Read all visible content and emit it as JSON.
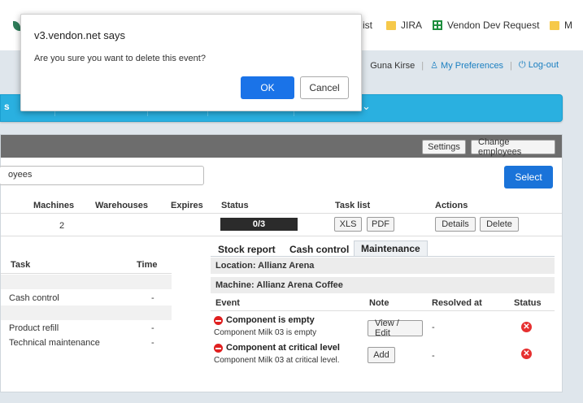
{
  "bookmarks": {
    "item1": "ist",
    "item2": "JIRA",
    "item3": "Vendon Dev Request",
    "item4": "M"
  },
  "userbar": {
    "user": "Guna Kirse",
    "preferences": "My Preferences",
    "logout": "Log-out"
  },
  "nav": {
    "partial_label": "s",
    "chevron": "⌄"
  },
  "panel": {
    "settings": "Settings",
    "change_employees": "Change employees",
    "search_value": "oyees",
    "select": "Select"
  },
  "table": {
    "headers": {
      "machines": "Machines",
      "warehouses": "Warehouses",
      "expires": "Expires",
      "status": "Status",
      "tasklist": "Task list",
      "actions": "Actions"
    },
    "row": {
      "machines": "2",
      "progress": "0/3",
      "progress_fraction": 0,
      "xls": "XLS",
      "pdf": "PDF",
      "details": "Details",
      "delete": "Delete"
    }
  },
  "tasks": {
    "headers": {
      "task": "Task",
      "time": "Time"
    },
    "rows": [
      {
        "task": "Cash control",
        "time": "-"
      },
      {
        "task": "Product refill",
        "time": "-"
      },
      {
        "task": "Technical maintenance",
        "time": "-"
      }
    ]
  },
  "detail": {
    "tabs": [
      "Stock report",
      "Cash control",
      "Maintenance"
    ],
    "location": "Location: Allianz Arena",
    "machine": "Machine: Allianz Arena Coffee",
    "headers": {
      "event": "Event",
      "note": "Note",
      "resolved": "Resolved at",
      "status": "Status"
    },
    "events": [
      {
        "title": "Component is empty",
        "desc": "Component Milk 03 is empty",
        "note_btn": "View / Edit",
        "resolved": "-"
      },
      {
        "title": "Component at critical level",
        "desc": "Component Milk 03 at critical level.",
        "note_btn": "Add",
        "resolved": "-"
      }
    ]
  },
  "dialog": {
    "title": "v3.vendon.net says",
    "message": "Are you sure you want to delete this event?",
    "ok": "OK",
    "cancel": "Cancel"
  }
}
